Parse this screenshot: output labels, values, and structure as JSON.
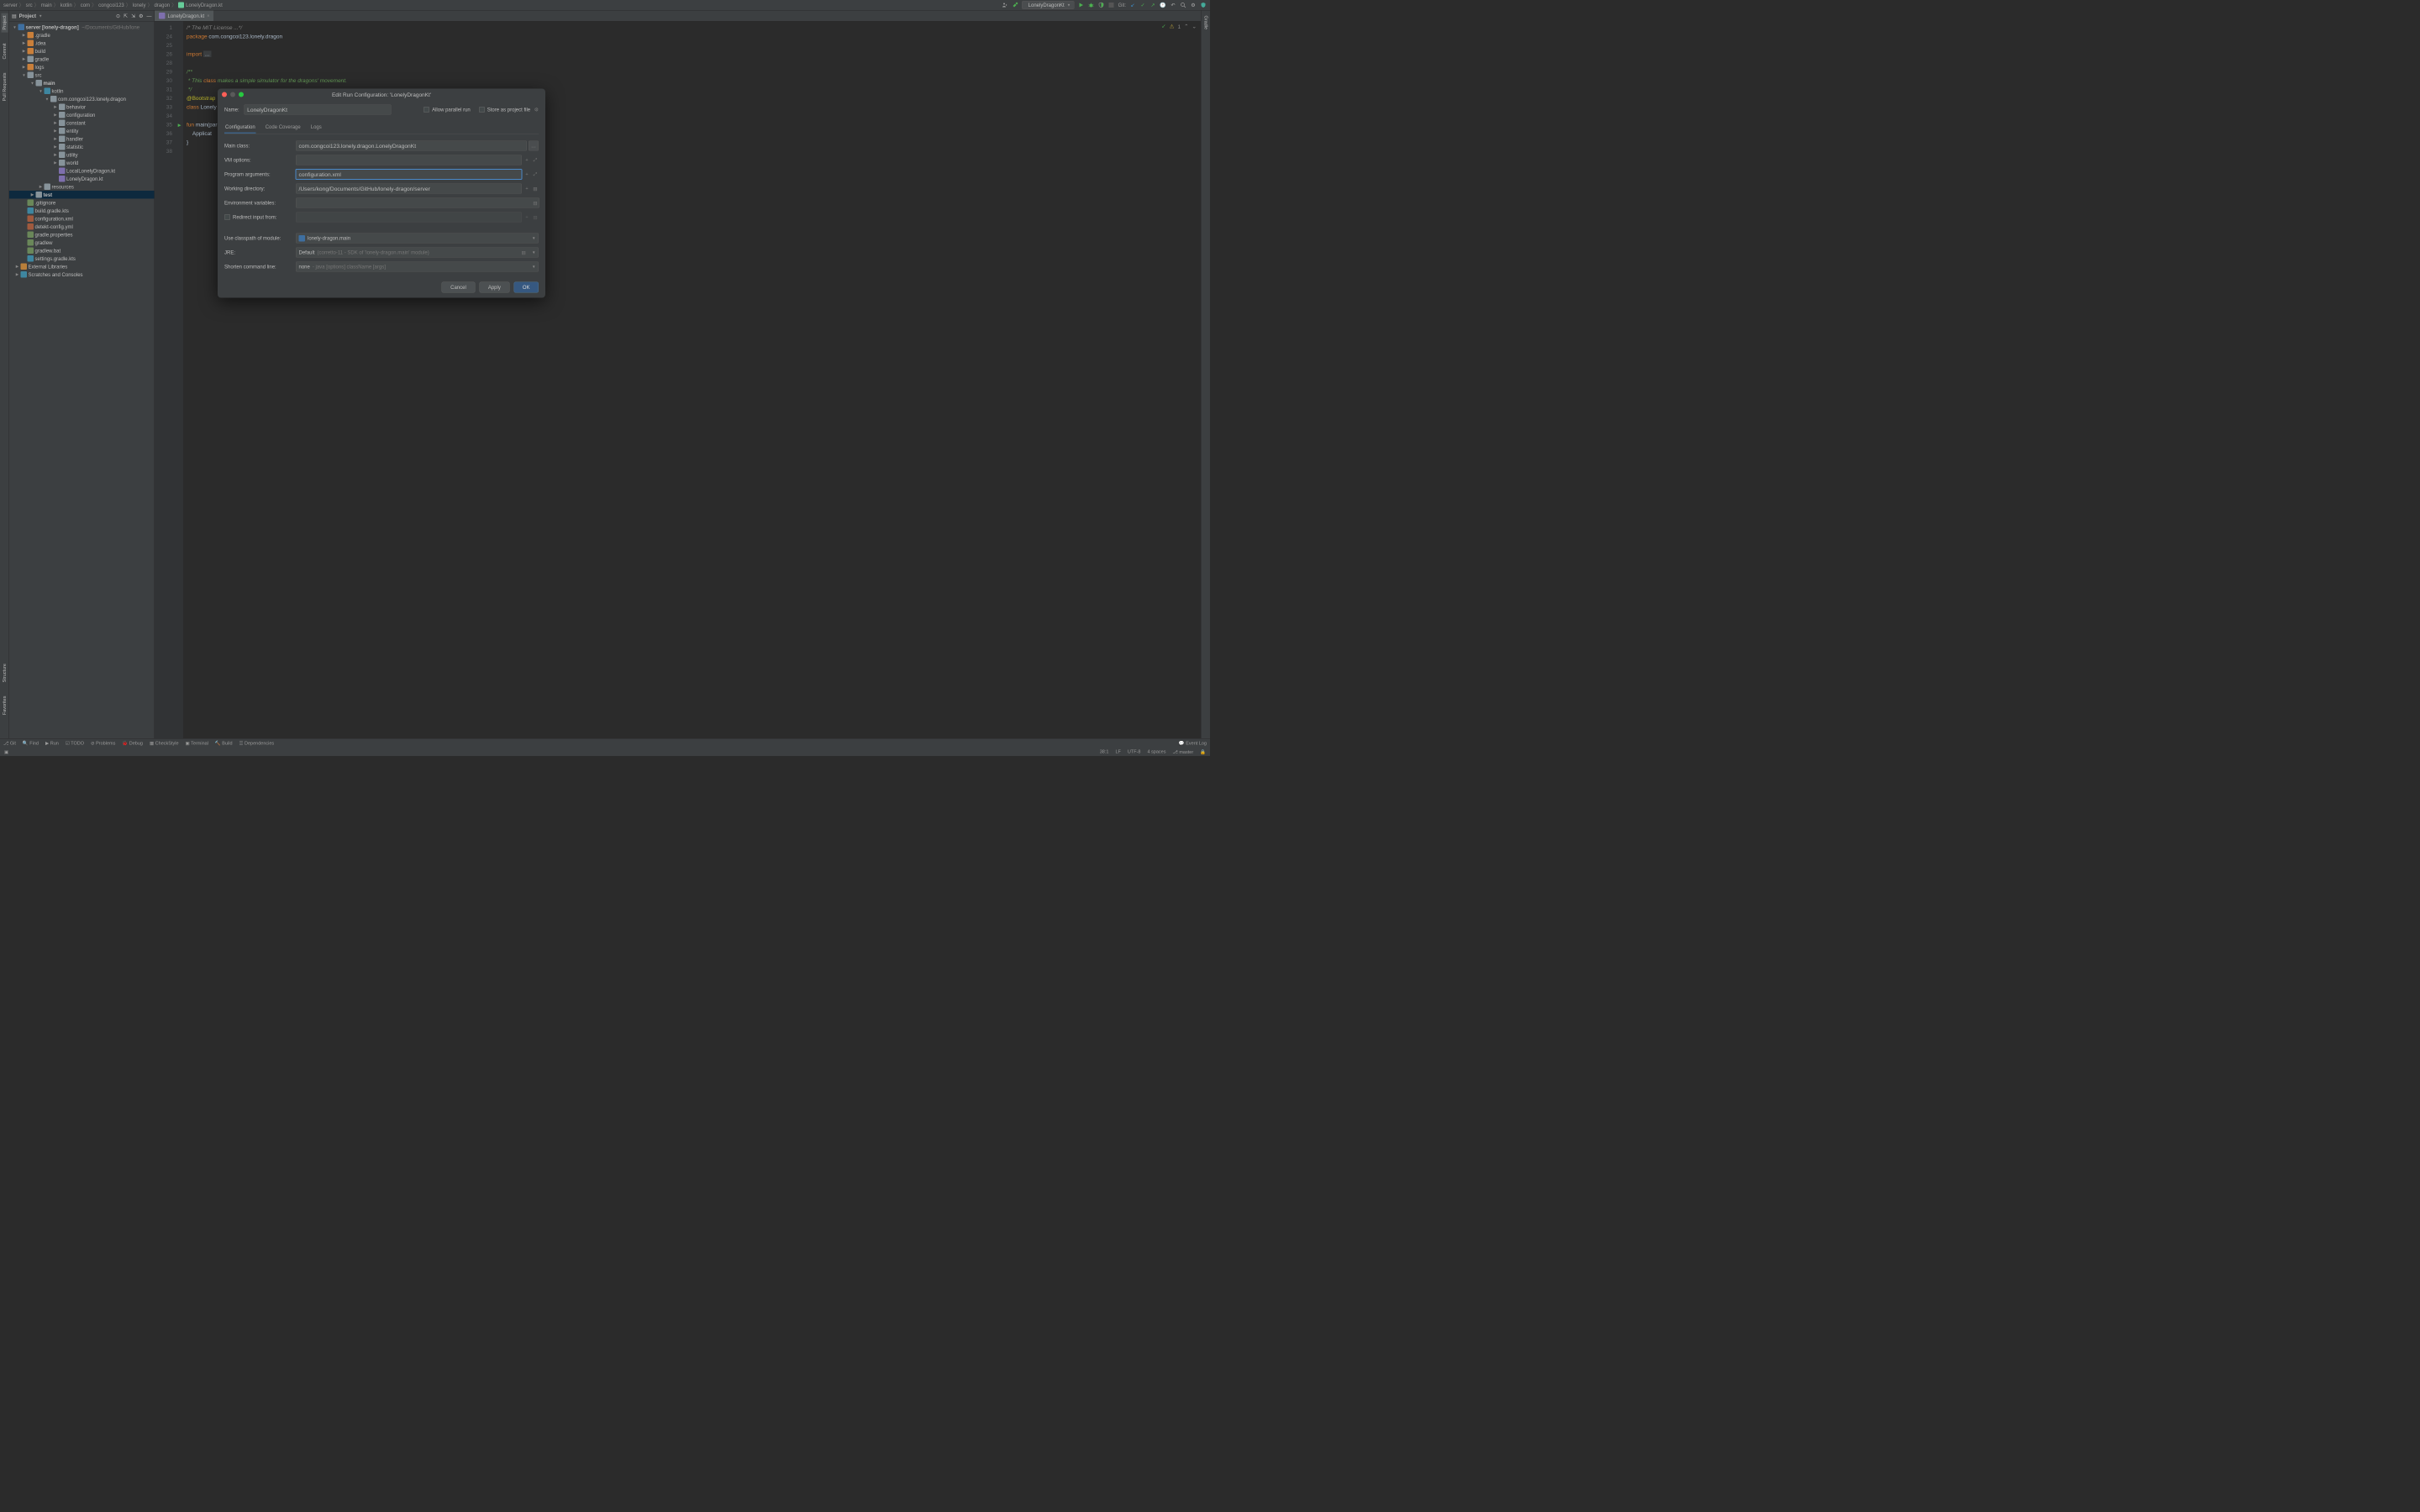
{
  "breadcrumb": [
    "server",
    "src",
    "main",
    "kotlin",
    "com",
    "congcoi123",
    "lonely",
    "dragon",
    "LonelyDragon.kt"
  ],
  "run_config_selector": "LonelyDragonKt",
  "git_label": "Git:",
  "left_tabs": {
    "project": "Project",
    "commit": "Commit",
    "pull": "Pull Requests"
  },
  "left_tabs_bottom": {
    "structure": "Structure",
    "favorites": "Favorites"
  },
  "right_tabs": {
    "gradle": "Gradle"
  },
  "project_panel": {
    "title": "Project",
    "root_label": "server",
    "root_alias": "[lonely-dragon]",
    "root_path": "~/Documents/GitHub/lone",
    "dirs_top": [
      ".gradle",
      ".idea",
      "build",
      "gradle",
      "logs"
    ],
    "src": "src",
    "main": {
      "name": "main",
      "kotlin": "kotlin",
      "package": "com.congcoi123.lonely.dragon",
      "subpackages": [
        "behavior",
        "configuration",
        "constant",
        "entity",
        "handler",
        "statistic",
        "utility",
        "world"
      ],
      "files": [
        "LocalLonelyDragon.kt",
        "LonelyDragon.kt"
      ]
    },
    "resources": "resources",
    "test": "test",
    "files": [
      ".gitignore",
      "build.gradle.kts",
      "configuration.xml",
      "detekt-config.yml",
      "gradle.properties",
      "gradlew",
      "gradlew.bat",
      "settings.gradle.kts"
    ],
    "ext_libs": "External Libraries",
    "scratches": "Scratches and Consoles"
  },
  "tab_file": "LonelyDragon.kt",
  "editor": {
    "start_line": 1,
    "lines": [
      "/* The MIT License ...*/",
      "package com.congcoi123.lonely.dragon",
      "",
      "import ...",
      "",
      "/**",
      " * This class makes a simple simulator for the dragons' movement.",
      " */",
      "@Bootstrap",
      "class Lonely",
      "",
      "fun main(par",
      "    Applicat",
      "}",
      ""
    ],
    "line_numbers": [
      1,
      24,
      25,
      26,
      28,
      29,
      30,
      31,
      32,
      33,
      34,
      35,
      36,
      37,
      38
    ],
    "indicator_count": "1"
  },
  "dialog": {
    "title": "Edit Run Configuration: 'LonelyDragonKt'",
    "name_label": "Name:",
    "name_value": "LonelyDragonKt",
    "allow_parallel": "Allow parallel run",
    "store_as_project": "Store as project file",
    "tabs": {
      "config": "Configuration",
      "coverage": "Code Coverage",
      "logs": "Logs"
    },
    "main_class_label": "Main class:",
    "main_class_value": "com.congcoi123.lonely.dragon.LonelyDragonKt",
    "vm_options_label": "VM options:",
    "vm_options_value": "",
    "program_args_label": "Program arguments:",
    "program_args_value": "configuration.xml",
    "working_dir_label": "Working directory:",
    "working_dir_value": "/Users/kong/Documents/GitHub/lonely-dragon/server",
    "env_vars_label": "Environment variables:",
    "env_vars_value": "",
    "redirect_label": "Redirect input from:",
    "redirect_value": "",
    "classpath_label": "Use classpath of module:",
    "classpath_value": "lonely-dragon.main",
    "jre_label": "JRE:",
    "jre_value_prefix": "Default",
    "jre_value_dim": "(corretto-11 - SDK of 'lonely-dragon.main' module)",
    "shorten_label": "Shorten command line:",
    "shorten_value_prefix": "none",
    "shorten_value_dim": "- java [options] className [args]",
    "buttons": {
      "cancel": "Cancel",
      "apply": "Apply",
      "ok": "OK"
    }
  },
  "bottombar": {
    "git": "Git",
    "find": "Find",
    "run": "Run",
    "todo": "TODO",
    "problems": "Problems",
    "debug": "Debug",
    "checkstyle": "CheckStyle",
    "terminal": "Terminal",
    "build": "Build",
    "dependencies": "Dependencies",
    "eventlog": "Event Log"
  },
  "statusbar": {
    "pos": "38:1",
    "le": "LF",
    "enc": "UTF-8",
    "indent": "4 spaces",
    "branch": "master"
  }
}
